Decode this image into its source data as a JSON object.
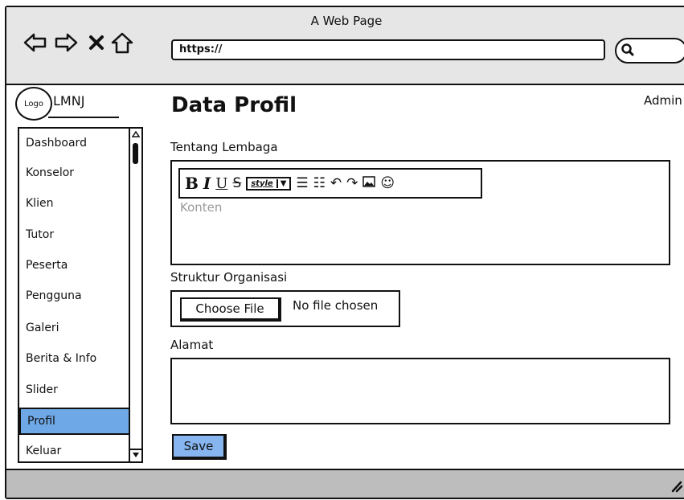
{
  "window": {
    "title": "A Web Page",
    "url": "https://"
  },
  "nav_icons": [
    "back-icon",
    "forward-icon",
    "close-icon",
    "home-icon",
    "search-icon"
  ],
  "brand": {
    "logo_text": "Logo",
    "name": "LMNJ"
  },
  "sidebar": {
    "items": [
      {
        "label": "Dashboard"
      },
      {
        "label": "Konselor"
      },
      {
        "label": "Klien"
      },
      {
        "label": "Tutor"
      },
      {
        "label": "Peserta"
      },
      {
        "label": "Pengguna"
      },
      {
        "label": "Galeri"
      },
      {
        "label": "Berita & Info"
      },
      {
        "label": "Slider"
      },
      {
        "label": "Profil",
        "active": true
      },
      {
        "label": "Keluar"
      }
    ]
  },
  "header": {
    "page_title": "Data Profil",
    "user": "Admin"
  },
  "form": {
    "tentang_label": "Tentang Lembaga",
    "editor": {
      "toolbar": {
        "bold": "B",
        "italic": "I",
        "underline": "U",
        "strike": "S",
        "style": "style"
      },
      "placeholder": "Konten"
    },
    "struktur_label": "Struktur Organisasi",
    "file": {
      "button": "Choose File",
      "status": "No file chosen"
    },
    "alamat_label": "Alamat",
    "save_label": "Save"
  },
  "colors": {
    "active_item": "#6fa8e6",
    "save_button": "#86b5ef",
    "chrome": "#e6e6e6",
    "statusbar": "#bdbdbd"
  }
}
